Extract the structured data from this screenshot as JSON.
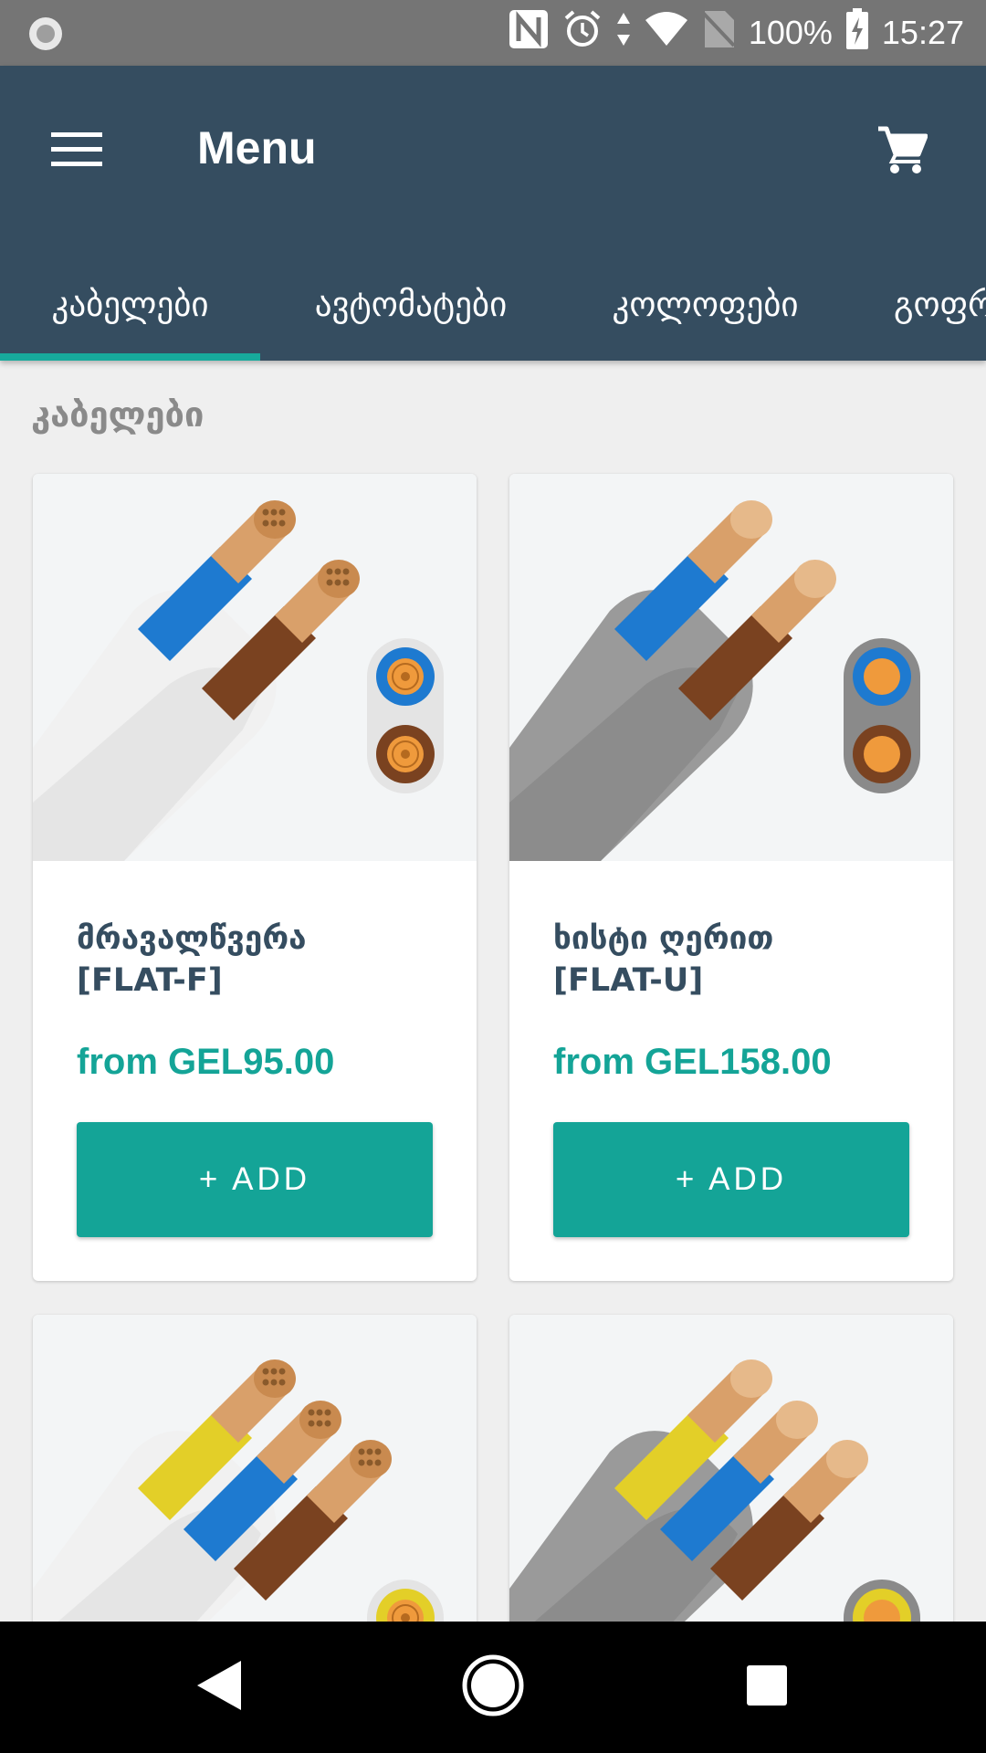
{
  "status_bar": {
    "battery": "100%",
    "time": "15:27",
    "icons": [
      "record-icon",
      "nfc-icon",
      "alarm-icon",
      "data-arrows-icon",
      "wifi-icon",
      "no-sim-icon",
      "battery-charging-icon"
    ]
  },
  "app_bar": {
    "title": "Menu",
    "menu_icon": "hamburger-icon",
    "cart_icon": "cart-icon"
  },
  "tabs": [
    {
      "label": "კაბელები",
      "active": true
    },
    {
      "label": "ავტომატები",
      "active": false
    },
    {
      "label": "კოლოფები",
      "active": false
    },
    {
      "label": "გოფრ",
      "active": false
    }
  ],
  "section": {
    "title": "კაბელები"
  },
  "products": [
    {
      "name_line1": "მრავალწვერა",
      "name_line2": "[FLAT-F]",
      "price": "from GEL95.00",
      "add_label": "+ ADD",
      "sheath": "#f1f1f1",
      "wires": 2,
      "stranded": true
    },
    {
      "name_line1": "ხისტი ღერით",
      "name_line2": "[FLAT-U]",
      "price": "from GEL158.00",
      "add_label": "+ ADD",
      "sheath": "#9a9a9a",
      "wires": 2,
      "stranded": false
    },
    {
      "name_line1": "",
      "name_line2": "",
      "price": "",
      "add_label": "",
      "sheath": "#f1f1f1",
      "wires": 3,
      "stranded": true
    },
    {
      "name_line1": "",
      "name_line2": "",
      "price": "",
      "add_label": "",
      "sheath": "#9a9a9a",
      "wires": 3,
      "stranded": false
    }
  ],
  "colors": {
    "app_bar": "#354d60",
    "accent": "#14a497",
    "wire_blue": "#1e7ad0",
    "wire_brown": "#7a4220",
    "wire_yellow": "#e3cf28",
    "copper": "#d9a06a"
  },
  "nav_bar": {
    "icons": [
      "back-icon",
      "home-icon",
      "recents-icon"
    ]
  }
}
